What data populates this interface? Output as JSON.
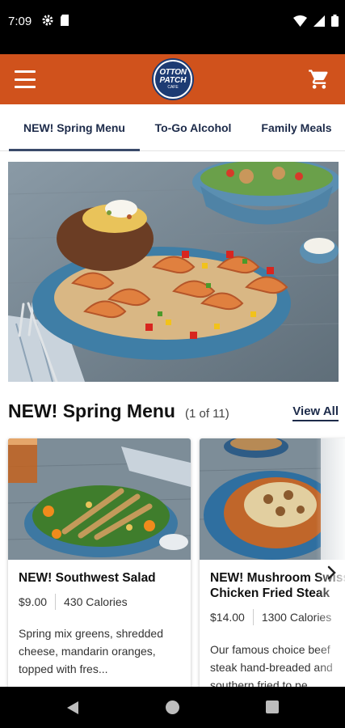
{
  "status_bar": {
    "time": "7:09",
    "left_icons": [
      "gear-icon",
      "sd-card-icon"
    ],
    "right_icons": [
      "wifi-icon",
      "signal-icon",
      "battery-icon"
    ]
  },
  "header": {
    "brand_color": "#d0521c",
    "logo": {
      "line1": "OTTON",
      "line2": "PATCH",
      "line3": "CAFE"
    },
    "menu_icon": "hamburger-icon",
    "cart_icon": "cart-icon"
  },
  "tabs": [
    {
      "label": "NEW! Spring Menu",
      "active": true
    },
    {
      "label": "To-Go Alcohol",
      "active": false
    },
    {
      "label": "Family Meals",
      "active": false
    }
  ],
  "section": {
    "title": "NEW! Spring Menu",
    "count": "(1 of 11)",
    "view_all": "View All"
  },
  "cards": [
    {
      "name": "NEW! Southwest Salad",
      "price": "$9.00",
      "calories": "430 Calories",
      "description": "Spring mix greens, shredded cheese, mandarin oranges, topped with fres..."
    },
    {
      "name": "NEW! Mushroom Swiss Chicken Fried Steak",
      "price": "$14.00",
      "calories": "1300 Calories",
      "description": "Our famous choice beef steak hand-breaded and southern fried to pe..."
    }
  ],
  "nav": {
    "back": "back-icon",
    "home": "home-icon",
    "recents": "recents-icon"
  }
}
